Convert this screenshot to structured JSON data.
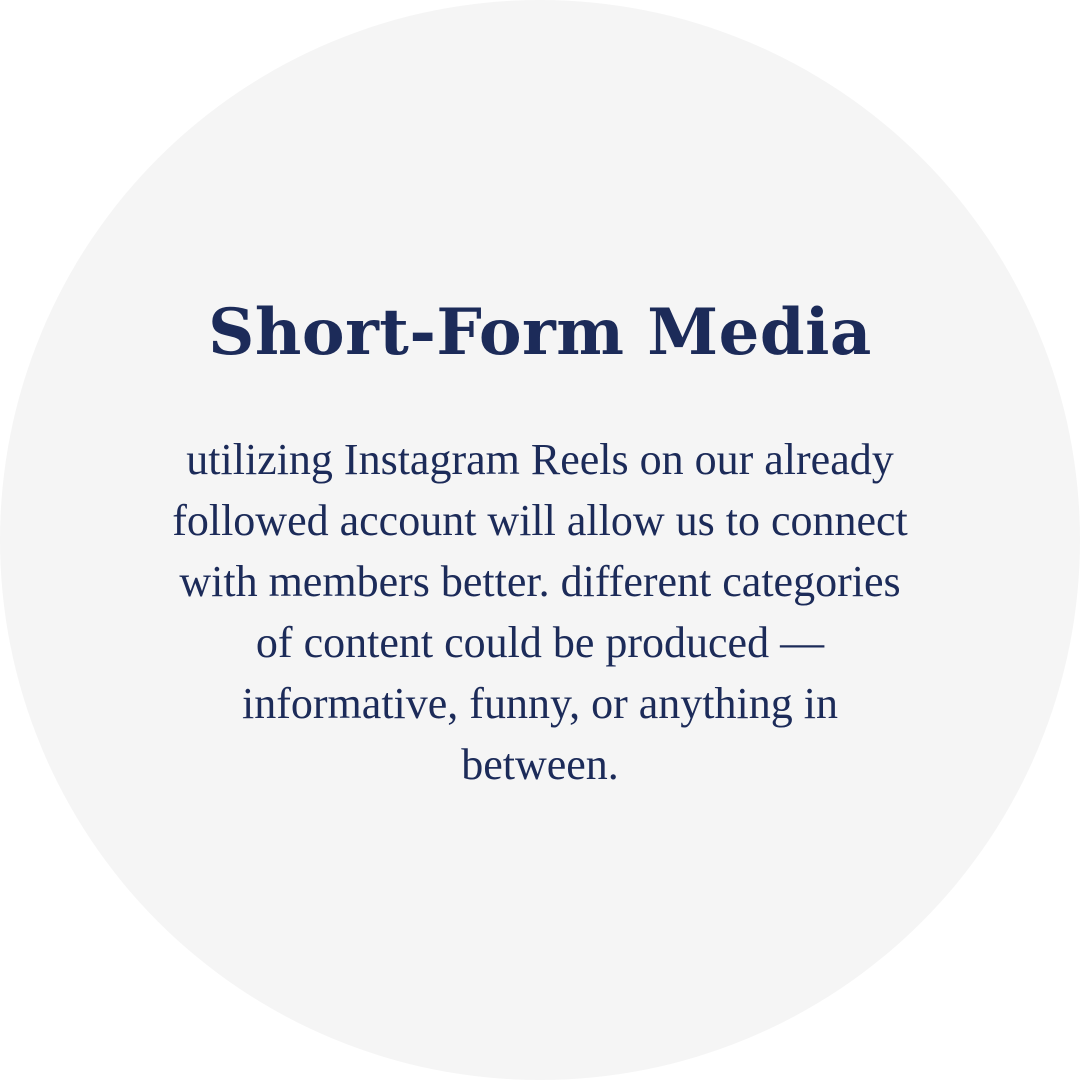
{
  "title": "Short-Form Media",
  "body_lines": [
    "utilizing Instagram Reels on our already",
    "followed account will allow us to connect",
    "with members better. different categories",
    "of content could be produced —",
    "informative, funny, or anything in",
    "between."
  ],
  "colors": {
    "text": "#1c2b59",
    "circle": "#f5f5f5",
    "background": "#ffffff"
  }
}
